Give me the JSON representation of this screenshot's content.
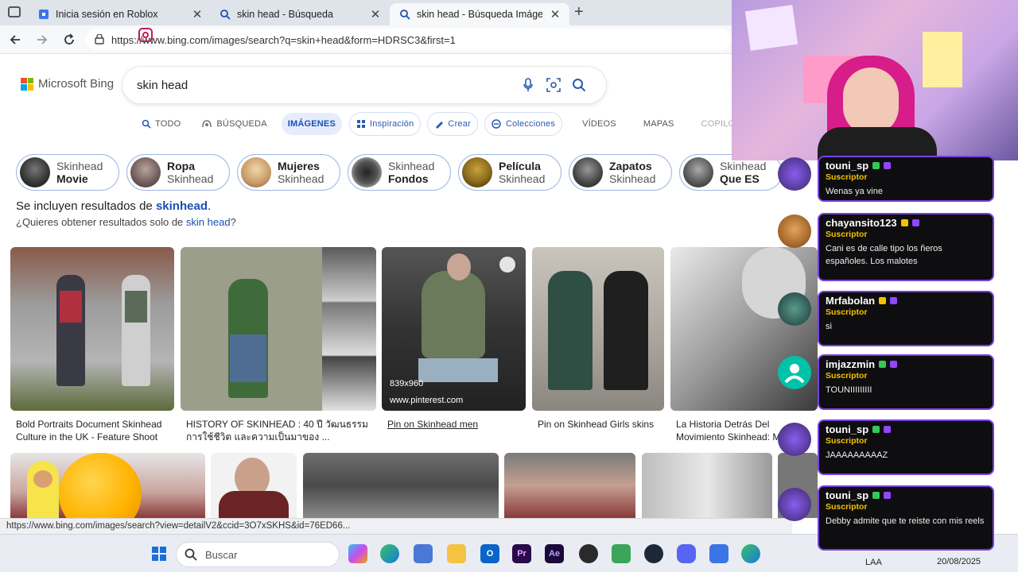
{
  "browser": {
    "tabs": [
      {
        "title": "Inicia sesión en Roblox",
        "icon": "roblox-icon"
      },
      {
        "title": "skin head - Búsqueda",
        "icon": "search-icon"
      },
      {
        "title": "skin head - Búsqueda Imágenes",
        "icon": "search-icon",
        "active": true
      }
    ],
    "new_tab_label": "+",
    "url": "https://www.bing.com/images/search?q=skin+head&form=HDRSC3&first=1"
  },
  "bing": {
    "logo_text": "Microsoft Bing",
    "query": "skin head",
    "scopes": [
      {
        "label": "TODO",
        "icon": "search-icon"
      },
      {
        "label": "BÚSQUEDA",
        "icon": "copilot-icon"
      },
      {
        "label": "IMÁGENES",
        "active": true
      },
      {
        "label": "Inspiración",
        "icon": "inspiration-icon",
        "pill": true
      },
      {
        "label": "Crear",
        "icon": "create-icon",
        "pill": true
      },
      {
        "label": "Colecciones",
        "icon": "collections-icon",
        "pill": true
      },
      {
        "label": "VÍDEOS"
      },
      {
        "label": "MAPAS"
      },
      {
        "label": "COPILO"
      }
    ],
    "chips": [
      {
        "top": "Skinhead",
        "bottom": "Movie",
        "bold": "bottom"
      },
      {
        "top": "Ropa",
        "bottom": "Skinhead",
        "bold": "top"
      },
      {
        "top": "Mujeres",
        "bottom": "Skinhead",
        "bold": "top"
      },
      {
        "top": "Skinhead",
        "bottom": "Fondos",
        "bold": "bottom"
      },
      {
        "top": "Película",
        "bottom": "Skinhead",
        "bold": "top"
      },
      {
        "top": "Zapatos",
        "bottom": "Skinhead",
        "bold": "top"
      },
      {
        "top": "Skinhead",
        "bottom": "Que ES",
        "bold": "bottom"
      }
    ],
    "included_prefix": "Se incluyen resultados de ",
    "included_term": "skinhead",
    "included_suffix": ".",
    "only_prefix": "¿Quieres obtener resultados solo de ",
    "only_term": "skin head",
    "only_suffix": "?",
    "images": [
      {
        "caption": "Bold Portraits Document Skinhead Culture in the UK - Feature Shoot"
      },
      {
        "caption": "HISTORY OF SKINHEAD : 40 ปี วัฒนธรรม การใช้ชีวิต และความเป็นมาของ ..."
      },
      {
        "caption": "Pin on Skinhead men",
        "size": "839x960",
        "source": "www.pinterest.com"
      },
      {
        "caption": "Pin on Skinhead Girls skins"
      },
      {
        "caption": "La Historia Detrás Del Movimiento Skinhead: Más Allá De L..."
      }
    ],
    "status_url": "https://www.bing.com/images/search?view=detailV2&ccid=3O7xSKHS&id=76ED66..."
  },
  "taskbar": {
    "search_placeholder": "Buscar",
    "lang": "LAA",
    "date": "20/08/2025",
    "apps": [
      "windows-start-icon",
      "copilot-icon",
      "edge-icon",
      "store-icon",
      "file-explorer-icon",
      "outlook-icon",
      "premiere-icon",
      "after-effects-icon",
      "obs-icon",
      "app-icon",
      "steam-icon",
      "discord-icon",
      "app-icon",
      "edge-icon"
    ]
  },
  "chat": [
    {
      "user": "touni_sp",
      "role": "Suscriptor",
      "text": "Wenas ya vine"
    },
    {
      "user": "chayansito123",
      "role": "Suscriptor",
      "text": "Cani es de calle tipo los ñeros españoles. Los malotes"
    },
    {
      "user": "Mrfabolan",
      "role": "Suscriptor",
      "text": "si"
    },
    {
      "user": "imjazzmin",
      "role": "Suscriptor",
      "text": "TOUNIIIIIIIII"
    },
    {
      "user": "touni_sp",
      "role": "Suscriptor",
      "text": "JAAAAAAAAAZ"
    },
    {
      "user": "touni_sp",
      "role": "Suscriptor",
      "text": "Debby admite que te reiste con mis reels"
    }
  ],
  "colors": {
    "accent": "#1a4fb3",
    "chat_border": "#7a3fe0",
    "subscriber": "#f3c200"
  }
}
